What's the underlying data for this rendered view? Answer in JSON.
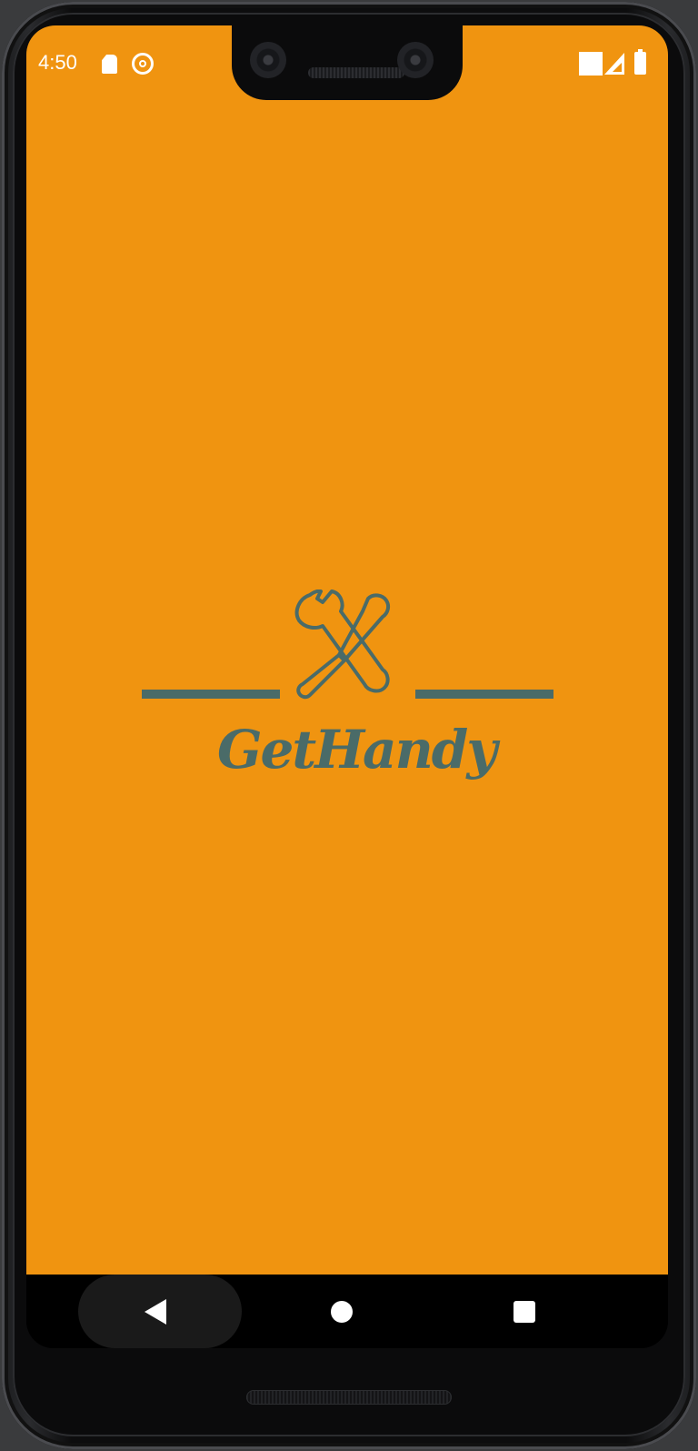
{
  "status_bar": {
    "time": "4:50",
    "icons": [
      "sd-card-icon",
      "sync-icon",
      "wifi-icon",
      "cell-signal-icon",
      "battery-icon"
    ]
  },
  "splash": {
    "brand_name": "GetHandy",
    "logo_icon": "wrench-screwdriver-icon",
    "background_color": "#f09410",
    "accent_color": "#4a6b68"
  },
  "nav_bar": {
    "buttons": [
      "back-icon",
      "home-icon",
      "recents-icon"
    ]
  }
}
